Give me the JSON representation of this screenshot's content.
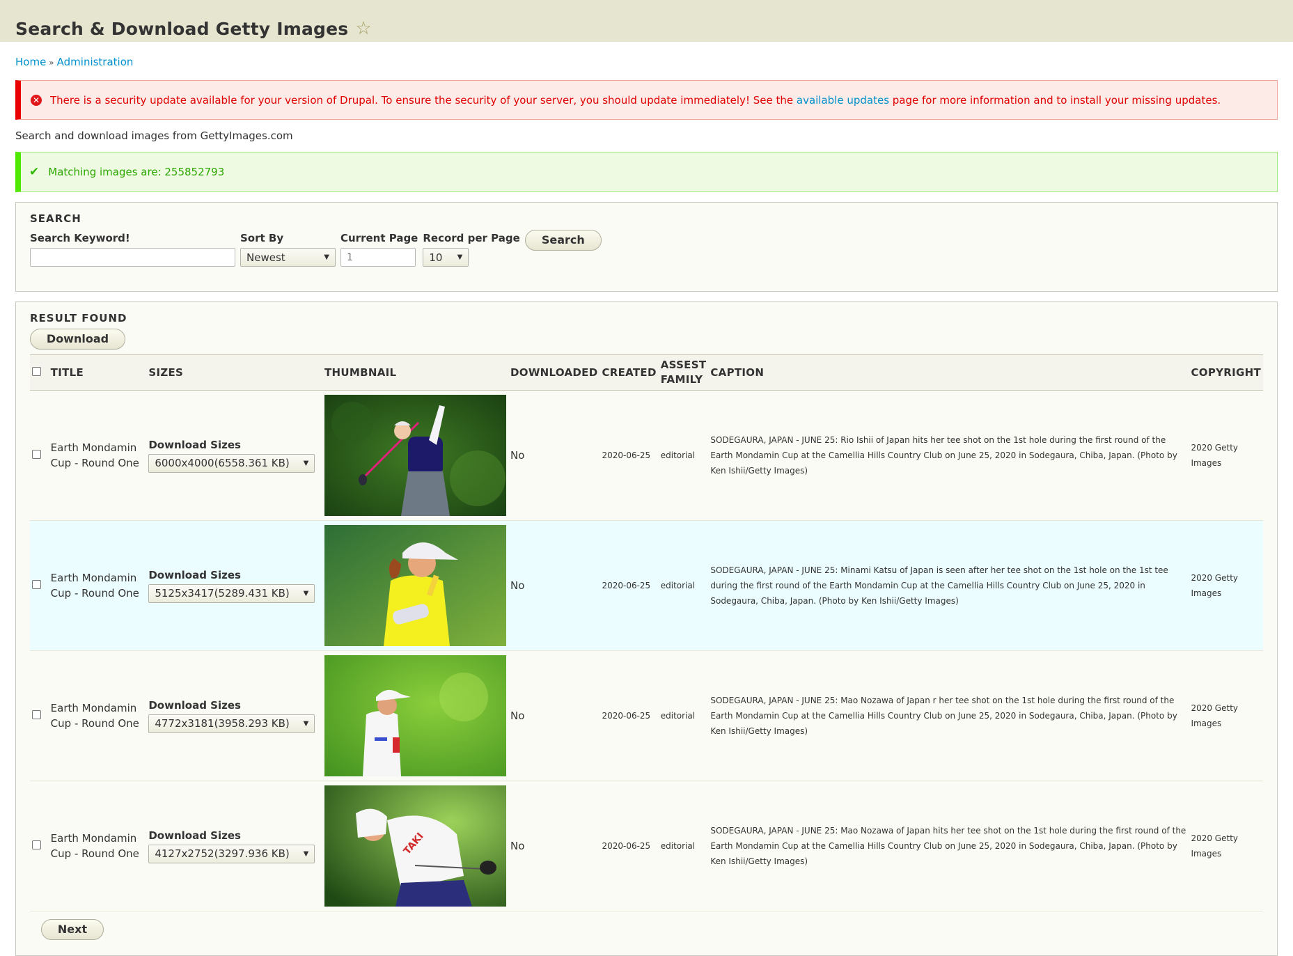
{
  "header": {
    "title": "Search & Download Getty Images",
    "star_icon": "star-outline"
  },
  "breadcrumb": {
    "items": [
      "Home",
      "Administration"
    ],
    "separator": "»"
  },
  "messages": {
    "error": {
      "icon": "error-circle-x",
      "text_before": "There is a security update available for your version of Drupal. To ensure the security of your server, you should update immediately! See the ",
      "link_text": "available updates",
      "text_after": " page for more information and to install your missing updates."
    },
    "status": {
      "icon": "checkmark",
      "text": "Matching images are: 255852793"
    }
  },
  "intro": "Search and download images from GettyImages.com",
  "search": {
    "legend": "SEARCH",
    "keyword_label": "Search Keyword!",
    "keyword_value": "",
    "sort_label": "Sort By",
    "sort_value": "Newest",
    "page_label": "Current Page",
    "page_placeholder": "1",
    "rpp_label": "Record per Page",
    "rpp_value": "10",
    "search_button": "Search"
  },
  "results": {
    "legend": "RESULT FOUND",
    "download_button": "Download",
    "columns": [
      "TITLE",
      "SIZES",
      "THUMBNAIL",
      "DOWNLOADED",
      "CREATED",
      "ASSEST FAMILY",
      "CAPTION",
      "COPYRIGHT"
    ],
    "sizes_label": "Download Sizes",
    "rows": [
      {
        "title": "Earth Mondamin Cup - Round One",
        "size": "6000x4000(6558.361 KB)",
        "thumbnail": "golfer-swing-navy-shirt",
        "downloaded": "No",
        "created": "2020-06-25",
        "family": "editorial",
        "caption": "SODEGAURA, JAPAN - JUNE 25: Rio Ishii of Japan hits her tee shot on the 1st hole during the first round of the Earth Mondamin Cup at the Camellia Hills Country Club on June 25, 2020 in Sodegaura, Chiba, Japan. (Photo by Ken Ishii/Getty Images)",
        "copyright": "2020 Getty Images"
      },
      {
        "title": "Earth Mondamin Cup - Round One",
        "size": "5125x3417(5289.431 KB)",
        "thumbnail": "golfer-yellow-shirt",
        "downloaded": "No",
        "created": "2020-06-25",
        "family": "editorial",
        "caption": "SODEGAURA, JAPAN - JUNE 25: Minami Katsu of Japan is seen after her tee shot on the 1st hole on the 1st tee during the first round of the Earth Mondamin Cup at the Camellia Hills Country Club on June 25, 2020 in Sodegaura, Chiba, Japan. (Photo by Ken Ishii/Getty Images)",
        "copyright": "2020 Getty Images"
      },
      {
        "title": "Earth Mondamin Cup - Round One",
        "size": "4772x3181(3958.293 KB)",
        "thumbnail": "golfer-white-shirt-standing",
        "downloaded": "No",
        "created": "2020-06-25",
        "family": "editorial",
        "caption": "SODEGAURA, JAPAN - JUNE 25: Mao Nozawa of Japan r her tee shot on the 1st hole during the first round of the Earth Mondamin Cup at the Camellia Hills Country Club on June 25, 2020 in Sodegaura, Chiba, Japan. (Photo by Ken Ishii/Getty Images)",
        "copyright": "2020 Getty Images"
      },
      {
        "title": "Earth Mondamin Cup - Round One",
        "size": "4127x2752(3297.936 KB)",
        "thumbnail": "golfer-white-shirt-swing",
        "downloaded": "No",
        "created": "2020-06-25",
        "family": "editorial",
        "caption": "SODEGAURA, JAPAN - JUNE 25: Mao Nozawa of Japan hits her tee shot on the 1st hole during the first round of the Earth Mondamin Cup at the Camellia Hills Country Club on June 25, 2020 in Sodegaura, Chiba, Japan. (Photo by Ken Ishii/Getty Images)",
        "copyright": "2020 Getty Images"
      }
    ],
    "next_button": "Next"
  },
  "colors": {
    "header_bg": "#e6e5cf",
    "link": "#0090cc",
    "error_text": "#e00000",
    "status_text": "#2ea600",
    "row_highlight": "#ebfdfe"
  }
}
